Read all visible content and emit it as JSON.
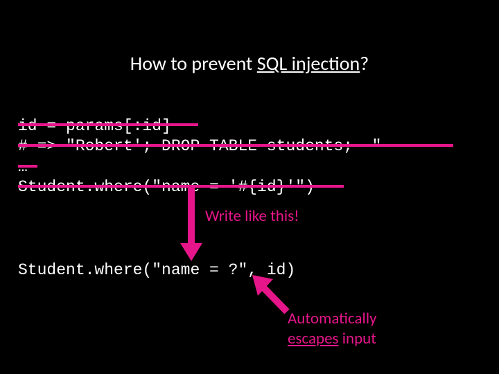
{
  "title": {
    "prefix": "How to prevent ",
    "underlined": "SQL injection",
    "suffix": "?"
  },
  "code1": {
    "line1": "id = params[:id]",
    "line2": "# => \"Robert'; DROP TABLE students;--\"",
    "line3": "…",
    "line4": "Student.where(\"name = '#{id}'\")"
  },
  "code2": {
    "line1": "Student.where(\"name = ?\", id)"
  },
  "labels": {
    "write": "Write like this!",
    "auto_word1": "Automatically",
    "auto_word2": "escapes",
    "auto_word3": " input"
  },
  "colors": {
    "accent": "#e6168a"
  }
}
